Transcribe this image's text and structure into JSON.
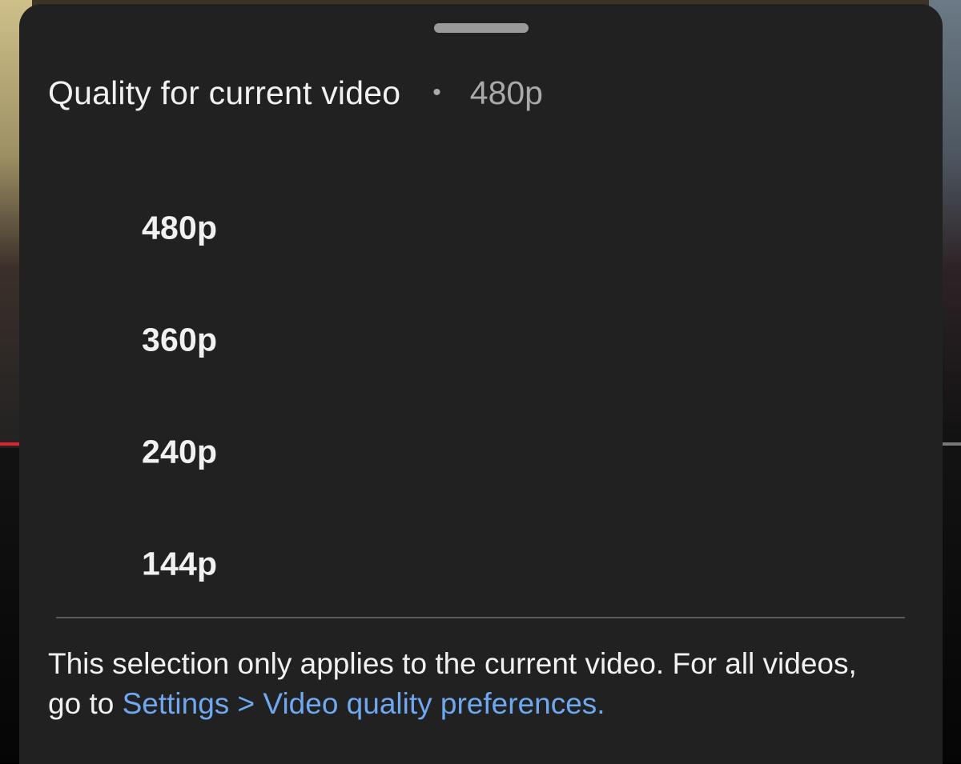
{
  "sheet": {
    "title": "Quality for current video",
    "separator": "•",
    "current_value": "480p"
  },
  "quality_options": [
    {
      "label": "480p"
    },
    {
      "label": "360p"
    },
    {
      "label": "240p"
    },
    {
      "label": "144p"
    }
  ],
  "footer": {
    "text": "This selection only applies to the current video. For all videos, go to ",
    "link": "Settings > Video quality preferences."
  },
  "colors": {
    "sheet_background": "#212121",
    "primary_text": "#f1f1f1",
    "secondary_text": "#aaaaaa",
    "link": "#6ea8f0",
    "progress_accent": "#e0242c"
  }
}
